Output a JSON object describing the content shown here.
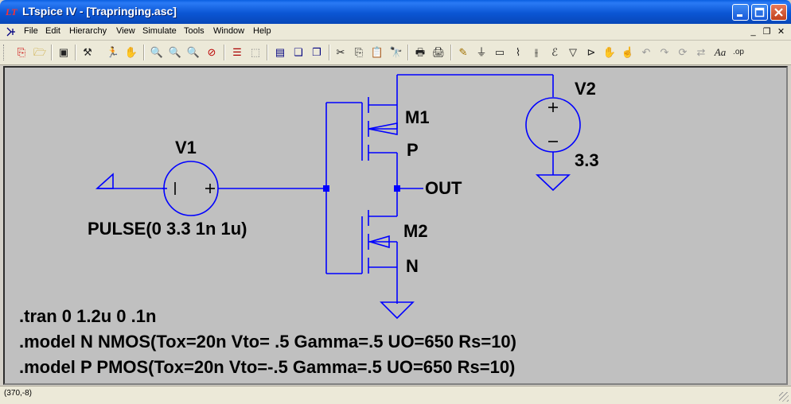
{
  "window": {
    "title": "LTspice IV - [Trapringing.asc]"
  },
  "menu": [
    {
      "label": "File"
    },
    {
      "label": "Edit"
    },
    {
      "label": "Hierarchy"
    },
    {
      "label": "View"
    },
    {
      "label": "Simulate"
    },
    {
      "label": "Tools"
    },
    {
      "label": "Window"
    },
    {
      "label": "Help"
    }
  ],
  "toolbar": {
    "icons": [
      "new-schematic-icon",
      "open-icon",
      "save-icon",
      "control-panel-icon",
      "run-icon",
      "halt-icon",
      "zoom-in-icon",
      "pan-icon",
      "zoom-out-icon",
      "zoom-cancel-icon",
      "autorange-icon",
      "zoom-full-icon",
      "tile-horizontal-icon",
      "cascade-icon",
      "close-window-icon",
      "cut-icon",
      "copy-icon",
      "paste-icon",
      "find-icon",
      "print-setup-icon",
      "print-icon",
      "draw-wire-icon",
      "ground-icon",
      "label-net-icon",
      "resistor-icon",
      "capacitor-icon",
      "inductor-icon",
      "diode-icon",
      "component-icon",
      "move-icon",
      "drag-icon",
      "undo-icon",
      "redo-icon",
      "rotate-icon",
      "mirror-icon",
      "text-icon",
      "spice-directive-icon"
    ]
  },
  "schematic": {
    "components": {
      "v1": {
        "name": "V1",
        "value": "PULSE(0 3.3 1n 1u)"
      },
      "v2": {
        "name": "V2",
        "value": "3.3"
      },
      "m1": {
        "name": "M1",
        "model": "P"
      },
      "m2": {
        "name": "M2",
        "model": "N"
      }
    },
    "net_label": "OUT",
    "directives": [
      ".tran 0 1.2u 0 .1n",
      ".model N NMOS(Tox=20n Vto= .5 Gamma=.5 UO=650 Rs=10)",
      ".model P PMOS(Tox=20n Vto=-.5 Gamma=.5 UO=650 Rs=10)"
    ],
    "colors": {
      "wire": "#0000ff",
      "text": "#000000",
      "background": "#c0c0c0",
      "junction": "#0000ff"
    }
  },
  "status": {
    "coords": "(370,-8)"
  }
}
